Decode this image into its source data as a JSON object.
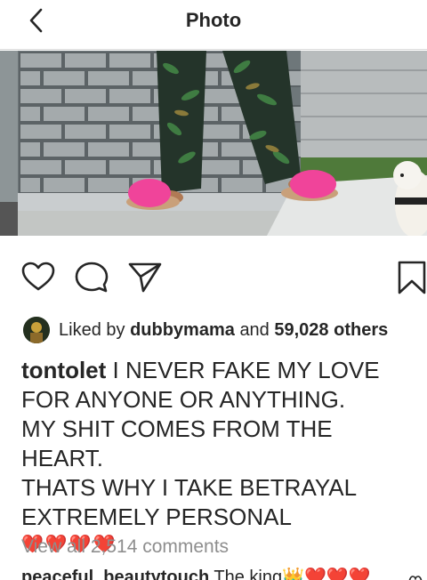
{
  "header": {
    "title": "Photo",
    "back_icon": "chevron-left-icon"
  },
  "post": {
    "actions": {
      "like_icon": "heart-outline-icon",
      "comment_icon": "speech-bubble-icon",
      "share_icon": "paper-plane-icon",
      "save_icon": "bookmark-outline-icon"
    },
    "likes": {
      "prefix": "Liked by",
      "user": "dubbymama",
      "connector": "and",
      "count": "59,028 others"
    },
    "caption": {
      "username": "tontolet",
      "text_line1": " I NEVER FAKE MY LOVE FOR ANYONE OR ANYTHING.",
      "text_line2": "MY SHIT COMES FROM THE HEART.",
      "text_line3": "THATS WHY I TAKE BETRAYAL EXTREMELY PERSONAL",
      "emojis": "❤️❤️❤️❤️"
    },
    "view_all_comments": "View all 2,514 comments",
    "first_comment": {
      "username": "peaceful_beautytouch",
      "text": " The king👑❤️❤️❤️"
    }
  },
  "colors": {
    "text": "#262626",
    "muted": "#8e8e8e",
    "divider": "#dbdbdb"
  }
}
